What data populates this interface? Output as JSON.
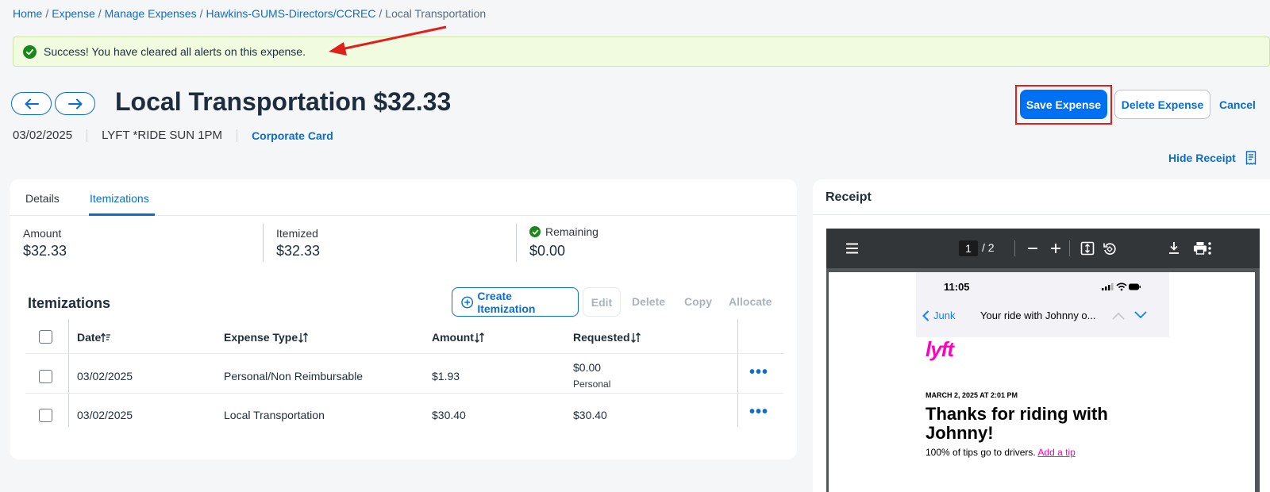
{
  "breadcrumb": {
    "home": "Home",
    "expense": "Expense",
    "manage": "Manage Expenses",
    "report": "Hawkins-GUMS-Directors/CCREC",
    "current": "Local Transportation",
    "sep": "/"
  },
  "banner": {
    "message": "Success! You have cleared all alerts on this expense."
  },
  "header": {
    "title": "Local Transportation $32.33",
    "date": "03/02/2025",
    "vendor": "LYFT *RIDE SUN 1PM",
    "payment": "Corporate Card"
  },
  "actions": {
    "save": "Save Expense",
    "delete": "Delete Expense",
    "cancel": "Cancel",
    "hide_receipt": "Hide Receipt"
  },
  "tabs": {
    "details": "Details",
    "itemizations": "Itemizations"
  },
  "summary": {
    "amount_label": "Amount",
    "amount_value": "$32.33",
    "itemized_label": "Itemized",
    "itemized_value": "$32.33",
    "remaining_label": "Remaining",
    "remaining_value": "$0.00"
  },
  "itemizations": {
    "title": "Itemizations",
    "create": "Create Itemization",
    "edit": "Edit",
    "delete": "Delete",
    "copy": "Copy",
    "allocate": "Allocate",
    "columns": {
      "date": "Date",
      "type": "Expense Type",
      "amount": "Amount",
      "requested": "Requested"
    },
    "rows": [
      {
        "date": "03/02/2025",
        "type": "Personal/Non Reimbursable",
        "amount": "$1.93",
        "requested": "$0.00",
        "requested_note": "Personal"
      },
      {
        "date": "03/02/2025",
        "type": "Local Transportation",
        "amount": "$30.40",
        "requested": "$30.40",
        "requested_note": ""
      }
    ]
  },
  "receipt": {
    "title": "Receipt",
    "page_current": "1",
    "page_total": "/ 2",
    "phone_time": "11:05",
    "back_label": "Junk",
    "email_subject": "Your ride with Johnny o...",
    "brand": "lyft",
    "date_line": "MARCH 2, 2025 AT 2:01 PM",
    "headline_1": "Thanks for riding with",
    "headline_2": "Johnny!",
    "tips_text": "100% of tips go to drivers.",
    "tip_link": "Add a tip"
  },
  "colors": {
    "accent": "#0a6ed1",
    "primary_button": "#0070f2",
    "success": "#188918",
    "annotation": "#e0201b",
    "lyft_pink": "#ff00bf"
  }
}
